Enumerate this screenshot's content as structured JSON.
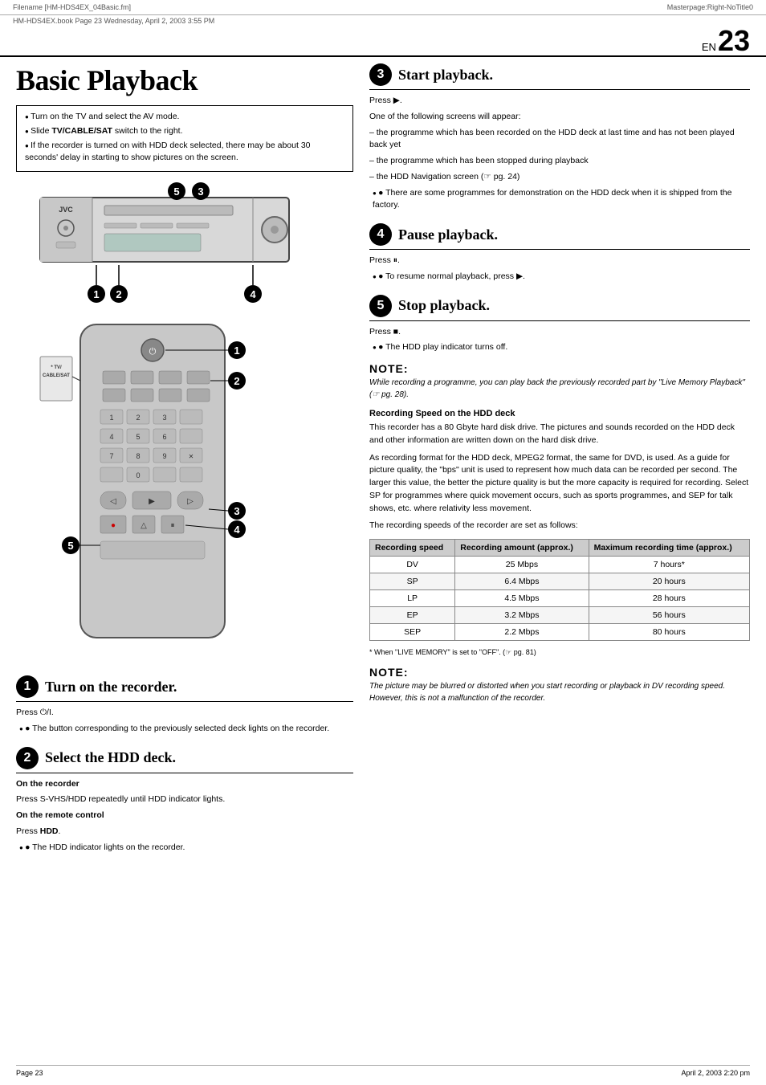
{
  "header": {
    "filename": "Filename [HM-HDS4EX_04Basic.fm]",
    "subline": "HM-HDS4EX.book  Page 23  Wednesday, April 2, 2003  3:55 PM",
    "masterpage": "Masterpage:Right-NoTitle0"
  },
  "page": {
    "en_label": "EN",
    "number": "23"
  },
  "title": "Basic Playback",
  "bullets": [
    "Turn on the TV and select the AV mode.",
    "Slide TV/CABLE/SAT switch to the right.",
    "If the recorder is turned on with HDD deck selected, there may be about 30 seconds' delay in starting to show pictures on the screen."
  ],
  "steps": [
    {
      "num": "1",
      "title": "Turn on the recorder.",
      "body_lines": [
        "Press ⏻/I.",
        "● The button corresponding to the previously selected deck lights on the recorder."
      ]
    },
    {
      "num": "2",
      "title": "Select the HDD deck.",
      "subsections": [
        {
          "label": "On the recorder",
          "text": "Press S-VHS/HDD repeatedly until HDD indicator lights."
        },
        {
          "label": "On the remote control",
          "text": "Press HDD."
        }
      ],
      "extra": "● The HDD indicator lights on the recorder."
    },
    {
      "num": "3",
      "title": "Start playback.",
      "press": "Press ▶.",
      "intro": "One of the following screens will appear:",
      "items": [
        "– the programme which has been recorded on the HDD deck at last time and has not been played back yet",
        "– the programme which has been stopped during playback",
        "– the HDD Navigation screen (☞ pg. 24)"
      ],
      "extra": "● There are some programmes for demonstration on the HDD deck when it is shipped from the factory."
    },
    {
      "num": "4",
      "title": "Pause playback.",
      "press": "Press ⏸.",
      "extra": "● To resume normal playback, press ▶."
    },
    {
      "num": "5",
      "title": "Stop playback.",
      "press": "Press ■.",
      "extra": "● The HDD play indicator turns off."
    }
  ],
  "note1": {
    "heading": "NOTE:",
    "text": "While recording a programme, you can play back the previously recorded part by \"Live Memory Playback\" (☞ pg. 28)."
  },
  "recording_speed": {
    "heading": "Recording Speed on the HDD deck",
    "intro": "This recorder has a 80 Gbyte hard disk drive. The pictures and sounds recorded on the HDD deck and other information are written down on the hard disk drive.",
    "para2": "As recording format for the HDD deck, MPEG2 format, the same for DVD, is used. As a guide for picture quality, the \"bps\" unit is used to represent how much data can be recorded per second. The larger this value, the better the picture quality is but the more capacity is required for recording. Select SP for programmes where quick movement occurs, such as sports programmes, and SEP for talk shows, etc. where relativity less movement.",
    "para3": "The recording speeds of the recorder are set as follows:",
    "table": {
      "headers": [
        "Recording speed",
        "Recording amount (approx.)",
        "Maximum recording time (approx.)"
      ],
      "rows": [
        [
          "DV",
          "25 Mbps",
          "7 hours*"
        ],
        [
          "SP",
          "6.4 Mbps",
          "20 hours"
        ],
        [
          "LP",
          "4.5 Mbps",
          "28 hours"
        ],
        [
          "EP",
          "3.2 Mbps",
          "56 hours"
        ],
        [
          "SEP",
          "2.2 Mbps",
          "80 hours"
        ]
      ]
    },
    "footnote": "* When \"LIVE MEMORY\" is set to \"OFF\". (☞ pg. 81)"
  },
  "note2": {
    "heading": "NOTE:",
    "text": "The picture may be blurred or distorted when you start recording or playback in DV recording speed. However, this is not a malfunction of the recorder."
  },
  "footer": {
    "left": "Page 23",
    "right": "April 2, 2003 2:20 pm"
  },
  "device": {
    "jvc_label": "JVC",
    "tv_cable_sat": "* TV/\nCABLE/SAT"
  },
  "callouts": {
    "deck": [
      "1",
      "2",
      "4",
      "5",
      "3"
    ],
    "remote": [
      "1",
      "2",
      "3",
      "4",
      "5"
    ]
  }
}
